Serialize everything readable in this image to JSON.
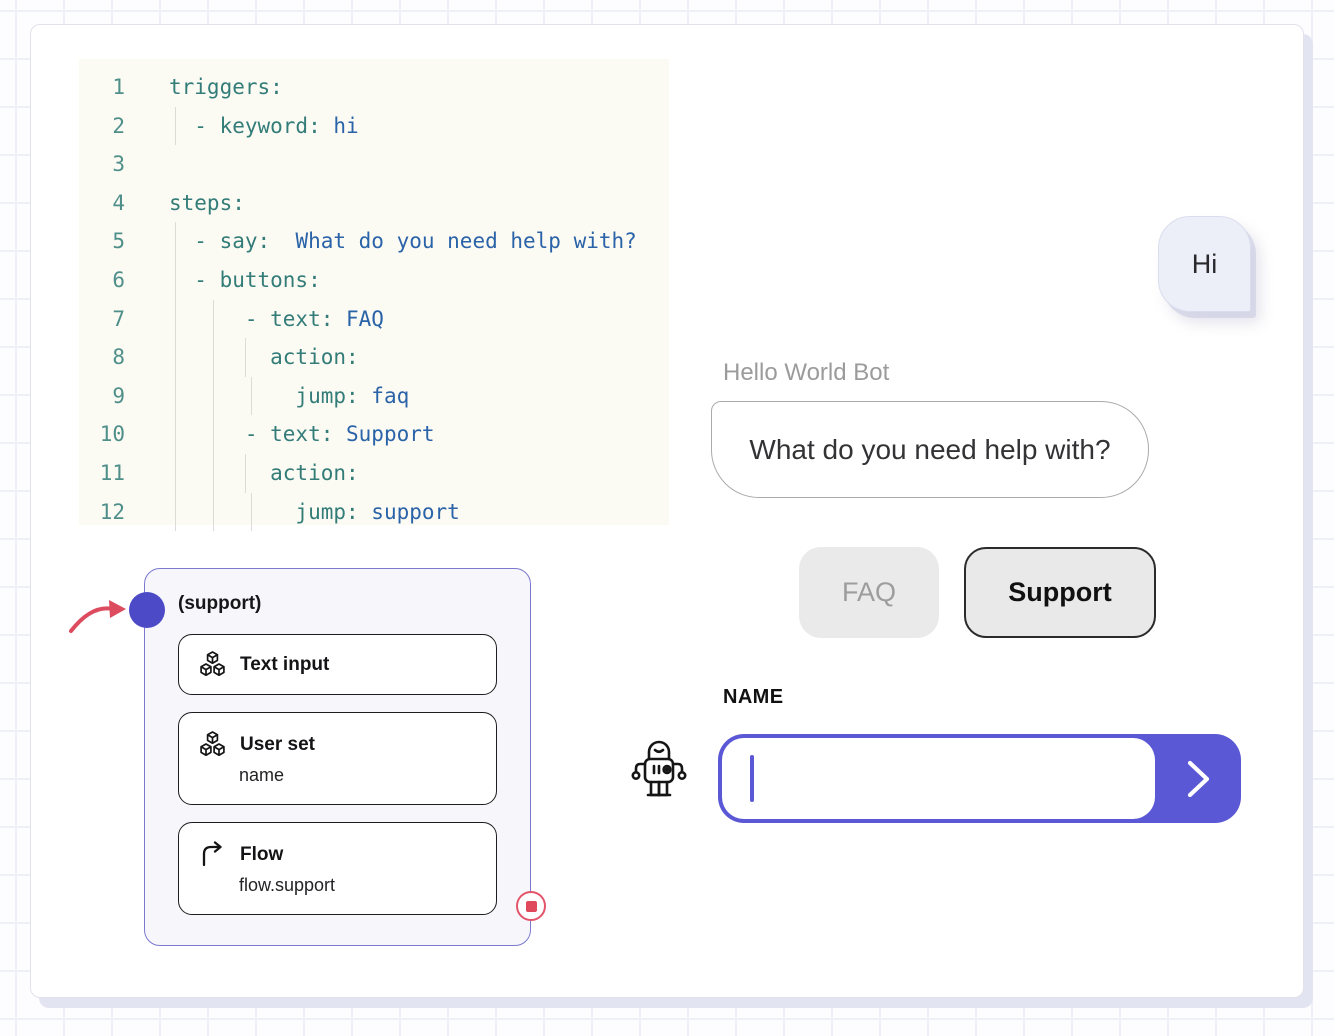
{
  "colors": {
    "accent": "#5a58d5",
    "port": "#4c4ac6",
    "node_border": "#7a79cf",
    "arrow_red": "#dc4b5e",
    "stop_red": "#e2556a",
    "code_key": "#337c78",
    "code_value": "#2a63a8",
    "code_line_number": "#4f8f8a",
    "code_bg": "#fbfaf3"
  },
  "code_editor": {
    "lines": [
      {
        "n": "1",
        "guides": [],
        "parts": [
          [
            "k",
            "triggers:"
          ]
        ]
      },
      {
        "n": "2",
        "guides": [
          0.5
        ],
        "parts": [
          [
            "k",
            "  - keyword: "
          ],
          [
            "v",
            "hi"
          ]
        ]
      },
      {
        "n": "3",
        "guides": [],
        "parts": []
      },
      {
        "n": "4",
        "guides": [],
        "parts": [
          [
            "k",
            "steps:"
          ]
        ]
      },
      {
        "n": "5",
        "guides": [
          0.5
        ],
        "parts": [
          [
            "k",
            "  - say: "
          ],
          [
            "v",
            " What do you need help with?"
          ]
        ]
      },
      {
        "n": "6",
        "guides": [
          0.5
        ],
        "parts": [
          [
            "k",
            "  - buttons:"
          ]
        ]
      },
      {
        "n": "7",
        "guides": [
          0.5,
          3.5
        ],
        "parts": [
          [
            "k",
            "      - text: "
          ],
          [
            "v",
            "FAQ"
          ]
        ]
      },
      {
        "n": "8",
        "guides": [
          0.5,
          3.5,
          6
        ],
        "parts": [
          [
            "k",
            "        action:"
          ]
        ]
      },
      {
        "n": "9",
        "guides": [
          0.5,
          3.5,
          6.5
        ],
        "parts": [
          [
            "k",
            "          jump: "
          ],
          [
            "v",
            "faq"
          ]
        ]
      },
      {
        "n": "10",
        "guides": [
          0.5,
          3.5
        ],
        "parts": [
          [
            "k",
            "      - text: "
          ],
          [
            "v",
            "Support"
          ]
        ]
      },
      {
        "n": "11",
        "guides": [
          0.5,
          3.5,
          6
        ],
        "parts": [
          [
            "k",
            "        action:"
          ]
        ]
      },
      {
        "n": "12",
        "guides": [
          0.5,
          3.5,
          6.5
        ],
        "parts": [
          [
            "k",
            "          jump: "
          ],
          [
            "v",
            "support"
          ]
        ]
      }
    ]
  },
  "flow_node": {
    "title": "(support)",
    "port_icon": "connection-port",
    "incoming_arrow_icon": "curved-arrow",
    "stop_icon": "stop-badge",
    "blocks": [
      {
        "icon": "cubes-icon",
        "title": "Text input",
        "subtitle": ""
      },
      {
        "icon": "cubes-icon",
        "title": "User set",
        "subtitle": "name"
      },
      {
        "icon": "flow-arrow-icon",
        "title": "Flow",
        "subtitle": "flow.support"
      }
    ]
  },
  "chat": {
    "user_message": "Hi",
    "bot_name": "Hello World Bot",
    "bot_message": "What do you need help with?",
    "quick_replies": [
      {
        "label": "FAQ",
        "emphasized": false
      },
      {
        "label": "Support",
        "emphasized": true
      }
    ],
    "input_label": "NAME",
    "input_value": "",
    "robot_icon": "robot-icon",
    "send_icon": "chevron-right-icon"
  }
}
